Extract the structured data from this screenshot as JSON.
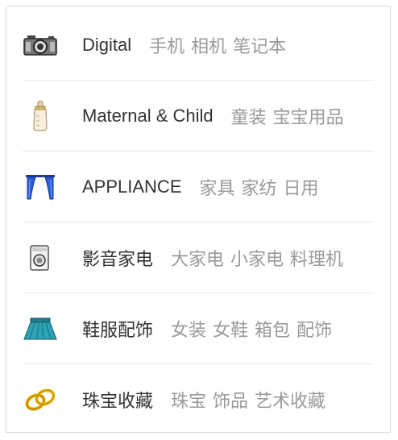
{
  "categories": [
    {
      "title": "Digital",
      "icon": "camera-icon",
      "subs": [
        "手机",
        "相机",
        "笔记本"
      ]
    },
    {
      "title": "Maternal & Child",
      "icon": "baby-bottle-icon",
      "subs": [
        "童装",
        "宝宝用品"
      ]
    },
    {
      "title": "APPLIANCE",
      "icon": "curtain-icon",
      "subs": [
        "家具",
        "家纺",
        "日用"
      ]
    },
    {
      "title": "影音家电",
      "icon": "washing-machine-icon",
      "subs": [
        "大家电",
        "小家电",
        "料理机"
      ]
    },
    {
      "title": "鞋服配饰",
      "icon": "skirt-icon",
      "subs": [
        "女装",
        "女鞋",
        "箱包",
        "配饰"
      ]
    },
    {
      "title": "珠宝收藏",
      "icon": "rings-icon",
      "subs": [
        "珠宝",
        "饰品",
        "艺术收藏"
      ]
    }
  ],
  "colors": {
    "title": "#333333",
    "subtitle": "#9a9a9a",
    "divider": "#e6e6e6",
    "border": "#d9d9d9"
  }
}
